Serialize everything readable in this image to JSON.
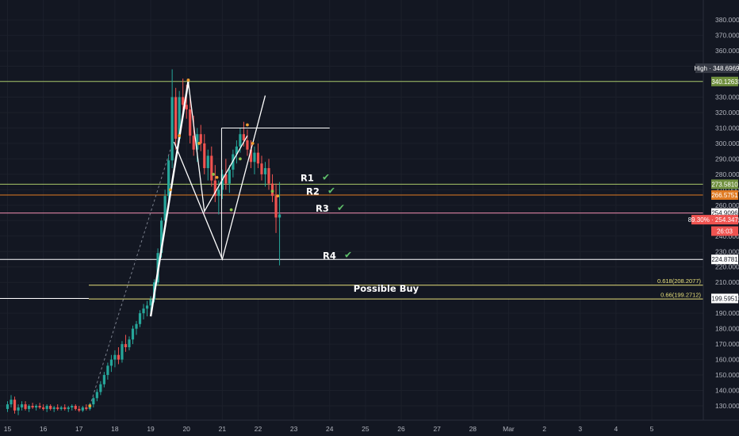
{
  "chart_data": {
    "type": "candlestick",
    "x_labels": [
      "15",
      "16",
      "17",
      "18",
      "19",
      "20",
      "21",
      "22",
      "23",
      "24",
      "25",
      "26",
      "27",
      "28",
      "Mar",
      "2",
      "3",
      "4",
      "5"
    ],
    "y_ticks": [
      "130.0000",
      "140.0000",
      "150.0000",
      "160.0000",
      "170.0000",
      "180.0000",
      "190.0000",
      "200.0000",
      "210.0000",
      "220.0000",
      "230.0000",
      "240.0000",
      "250.0000",
      "260.0000",
      "270.0000",
      "280.0000",
      "290.0000",
      "300.0000",
      "310.0000",
      "320.0000",
      "330.0000",
      "340.0000",
      "350.0000",
      "360.0000",
      "370.0000",
      "380.0000"
    ],
    "ylim": [
      121,
      391
    ],
    "high_tag": {
      "label": "High · 348.6969",
      "value": 348.6969
    },
    "price_tags": [
      {
        "label": "340.1263",
        "value": 340.1263,
        "bg": "#6f8f3e",
        "fg": "#ffffff"
      },
      {
        "label": "273.5810",
        "value": 273.581,
        "bg": "#6f8f3e",
        "fg": "#ffffff"
      },
      {
        "label": "266.5751",
        "value": 266.5751,
        "bg": "#e07b22",
        "fg": "#ffffff"
      },
      {
        "label": "254.9096",
        "value": 254.9096,
        "bg": "#ffffff",
        "fg": "#131722"
      },
      {
        "label": "89.30% · 254.3472",
        "value": 250.6,
        "bg": "#ef5350",
        "fg": "#ffffff"
      },
      {
        "label": "26:03",
        "value": 243.2,
        "bg": "#ef5350",
        "fg": "#ffffff"
      },
      {
        "label": "224.8781",
        "value": 224.8781,
        "bg": "#ffffff",
        "fg": "#131722"
      },
      {
        "label": "199.5951",
        "value": 199.5951,
        "bg": "#ffffff",
        "fg": "#131722"
      }
    ],
    "levels": [
      {
        "value": 340.1263,
        "color": "#a8c76a"
      },
      {
        "value": 273.581,
        "color": "#a8c76a"
      },
      {
        "value": 266.5751,
        "color": "#e07b22"
      },
      {
        "value": 254.9096,
        "color": "#f48fb1"
      },
      {
        "value": 224.8781,
        "color": "#ffffff"
      }
    ],
    "resistance_labels": [
      "R1",
      "R2",
      "R3",
      "R4"
    ],
    "resistance_levels": [
      277.5,
      268.9,
      257.8,
      227.4
    ],
    "fib_levels": [
      {
        "label": "0.618(208.2077)",
        "value": 208.2077
      },
      {
        "label": "0.66(199.2712)",
        "value": 199.2712
      }
    ],
    "zone_label": "Possible Buy",
    "zone": [
      199.27,
      208.21
    ],
    "pattern_points": [
      {
        "day": 19.0,
        "price": 188
      },
      {
        "day": 19.65,
        "price": 301
      },
      {
        "day": 20.05,
        "price": 340
      },
      {
        "day": 20.5,
        "price": 256
      },
      {
        "day": 21.7,
        "price": 305
      },
      {
        "day": 21.0,
        "price": 225
      },
      {
        "day": 22.2,
        "price": 331
      },
      {
        "day": 20.45,
        "price": 304
      }
    ],
    "candles": [
      [
        15.0,
        128,
        133,
        126,
        131
      ],
      [
        15.1,
        131,
        137,
        129,
        134
      ],
      [
        15.2,
        134,
        136,
        125,
        127
      ],
      [
        15.3,
        127,
        131,
        124,
        129
      ],
      [
        15.4,
        129,
        133,
        127,
        131
      ],
      [
        15.5,
        131,
        133,
        127,
        128
      ],
      [
        15.6,
        128,
        131,
        126,
        130
      ],
      [
        15.7,
        130,
        132,
        128,
        129
      ],
      [
        15.8,
        129,
        131,
        127,
        130
      ],
      [
        15.9,
        130,
        132,
        128,
        129
      ],
      [
        16.0,
        129,
        131,
        127,
        128
      ],
      [
        16.1,
        128,
        131,
        126,
        130
      ],
      [
        16.2,
        130,
        131,
        127,
        128
      ],
      [
        16.3,
        128,
        130,
        126,
        129
      ],
      [
        16.4,
        129,
        131,
        127,
        128
      ],
      [
        16.5,
        128,
        130,
        127,
        129
      ],
      [
        16.6,
        129,
        131,
        127,
        128
      ],
      [
        16.7,
        128,
        130,
        126,
        129
      ],
      [
        16.8,
        129,
        131,
        127,
        130
      ],
      [
        16.9,
        130,
        131,
        127,
        128
      ],
      [
        17.0,
        128,
        130,
        126,
        127
      ],
      [
        17.1,
        127,
        130,
        126,
        129
      ],
      [
        17.2,
        129,
        131,
        127,
        128
      ],
      [
        17.3,
        128,
        132,
        127,
        131
      ],
      [
        17.4,
        131,
        136,
        129,
        135
      ],
      [
        17.5,
        135,
        141,
        133,
        139
      ],
      [
        17.6,
        139,
        146,
        137,
        144
      ],
      [
        17.7,
        144,
        152,
        142,
        150
      ],
      [
        17.8,
        150,
        158,
        147,
        156
      ],
      [
        17.9,
        156,
        163,
        152,
        160
      ],
      [
        18.0,
        160,
        166,
        155,
        163
      ],
      [
        18.1,
        163,
        168,
        157,
        160
      ],
      [
        18.2,
        160,
        172,
        158,
        170
      ],
      [
        18.3,
        170,
        176,
        165,
        168
      ],
      [
        18.4,
        168,
        175,
        166,
        173
      ],
      [
        18.5,
        173,
        182,
        170,
        180
      ],
      [
        18.6,
        180,
        185,
        176,
        183
      ],
      [
        18.7,
        183,
        192,
        181,
        190
      ],
      [
        18.8,
        190,
        196,
        186,
        193
      ],
      [
        18.9,
        193,
        198,
        188,
        195
      ],
      [
        19.0,
        195,
        201,
        190,
        199
      ],
      [
        19.1,
        199,
        212,
        197,
        210
      ],
      [
        19.2,
        210,
        232,
        208,
        229
      ],
      [
        19.3,
        229,
        252,
        226,
        250
      ],
      [
        19.4,
        250,
        270,
        246,
        266
      ],
      [
        19.5,
        266,
        292,
        262,
        289
      ],
      [
        19.6,
        289,
        348,
        284,
        330
      ],
      [
        19.7,
        330,
        336,
        296,
        303
      ],
      [
        19.8,
        303,
        334,
        300,
        330
      ],
      [
        19.9,
        330,
        342,
        318,
        325
      ],
      [
        20.0,
        325,
        338,
        316,
        322
      ],
      [
        20.1,
        322,
        330,
        300,
        305
      ],
      [
        20.2,
        305,
        318,
        292,
        296
      ],
      [
        20.3,
        296,
        310,
        288,
        306
      ],
      [
        20.4,
        306,
        312,
        295,
        300
      ],
      [
        20.5,
        300,
        306,
        280,
        284
      ],
      [
        20.6,
        284,
        296,
        276,
        292
      ],
      [
        20.7,
        292,
        298,
        272,
        276
      ],
      [
        20.8,
        276,
        286,
        262,
        266
      ],
      [
        20.9,
        266,
        276,
        254,
        270
      ],
      [
        21.0,
        270,
        283,
        264,
        280
      ],
      [
        21.1,
        280,
        290,
        270,
        274
      ],
      [
        21.2,
        274,
        286,
        268,
        283
      ],
      [
        21.3,
        283,
        296,
        278,
        293
      ],
      [
        21.4,
        293,
        302,
        287,
        298
      ],
      [
        21.5,
        298,
        310,
        294,
        306
      ],
      [
        21.6,
        306,
        314,
        298,
        302
      ],
      [
        21.7,
        302,
        309,
        292,
        296
      ],
      [
        21.8,
        296,
        302,
        284,
        288
      ],
      [
        21.9,
        288,
        298,
        280,
        294
      ],
      [
        22.0,
        294,
        300,
        284,
        287
      ],
      [
        22.1,
        287,
        292,
        276,
        280
      ],
      [
        22.2,
        280,
        288,
        272,
        284
      ],
      [
        22.3,
        284,
        290,
        270,
        274
      ],
      [
        22.4,
        274,
        280,
        262,
        266
      ],
      [
        22.5,
        266,
        274,
        242,
        252
      ],
      [
        22.6,
        252,
        275,
        221,
        254
      ]
    ]
  }
}
